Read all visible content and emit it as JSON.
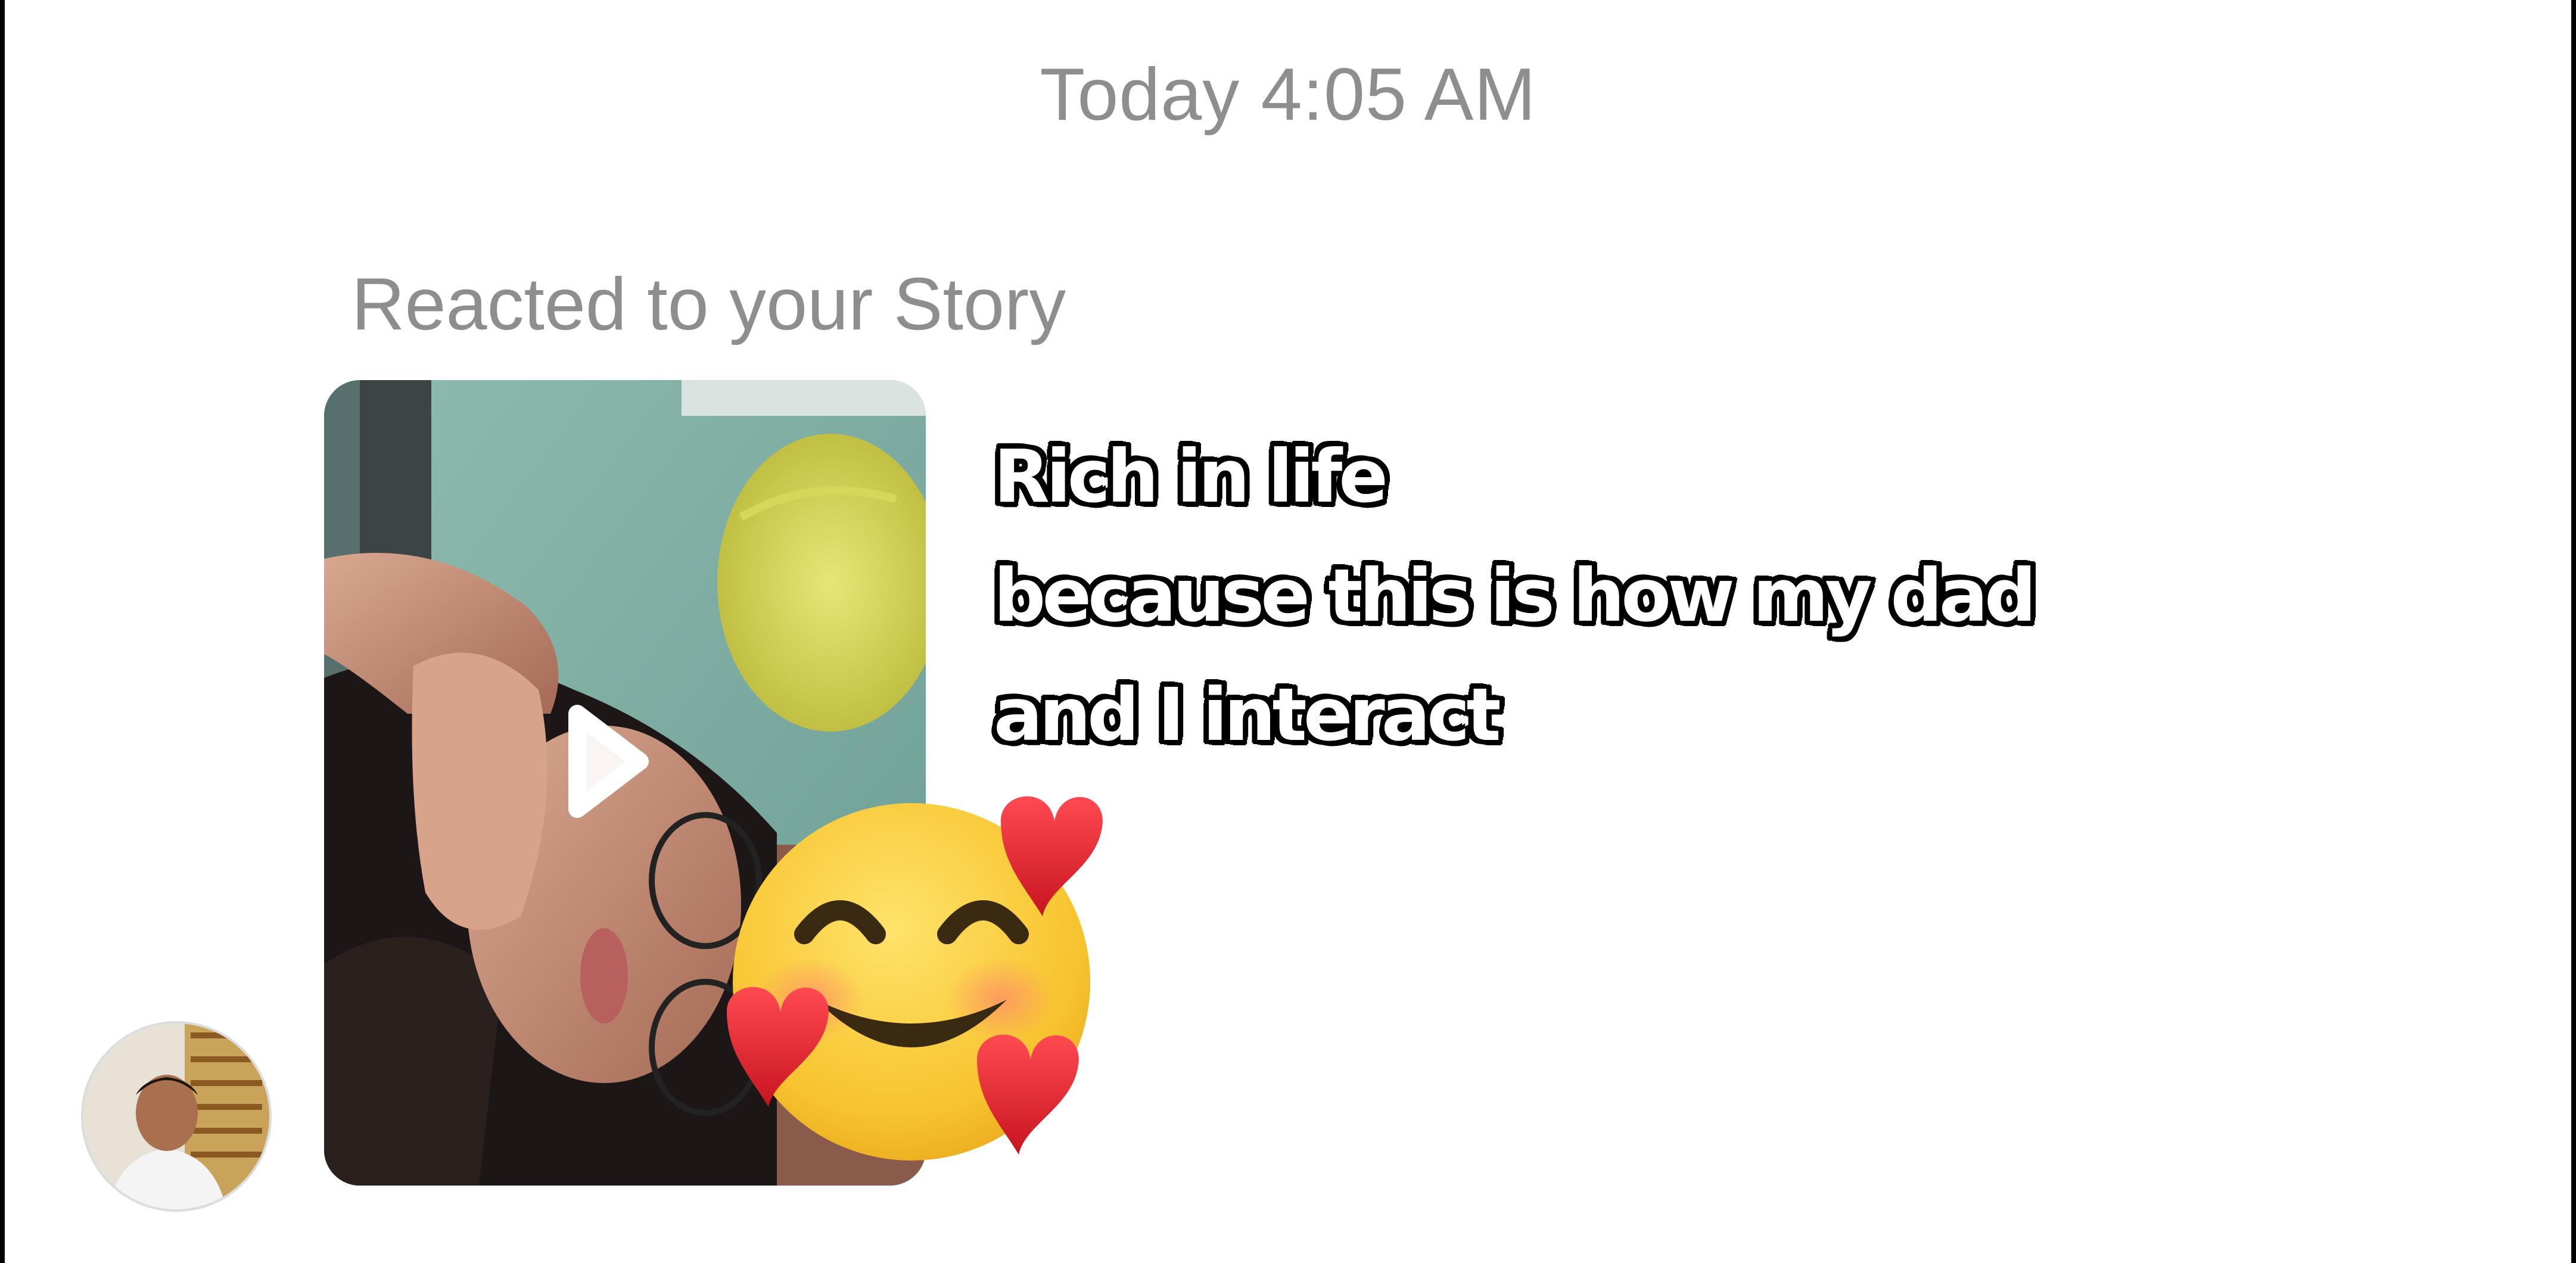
{
  "header": {
    "timestamp": "Today 4:05 AM"
  },
  "message": {
    "reacted_label": "Reacted to your Story",
    "story_caption_lines": [
      "Rich in life",
      "because this is how my dad",
      "and I interact"
    ],
    "reaction": "smiling-face-with-hearts",
    "reaction_colors": {
      "face": "#f7c32e",
      "heart": "#e2202c"
    }
  },
  "sender": {
    "avatar": "profile-photo"
  },
  "story": {
    "media_type": "video",
    "play_icon": "play-icon"
  }
}
